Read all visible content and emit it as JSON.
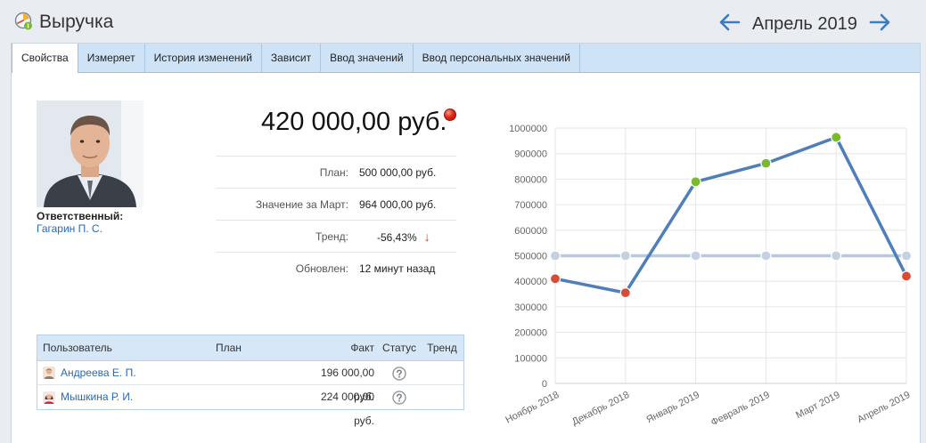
{
  "header": {
    "title": "Выручка",
    "period": "Апрель 2019"
  },
  "tabs": [
    {
      "label": "Свойства",
      "active": true
    },
    {
      "label": "Измеряет"
    },
    {
      "label": "История изменений"
    },
    {
      "label": "Зависит"
    },
    {
      "label": "Ввод значений"
    },
    {
      "label": "Ввод персональных значений"
    }
  ],
  "responsible": {
    "label": "Ответственный:",
    "name": "Гагарин П. С."
  },
  "kpi": {
    "value": "420 000,00 руб.",
    "status_color": "#e02818",
    "rows": [
      {
        "label": "План:",
        "value": "500 000,00 руб."
      },
      {
        "label": "Значение за Март:",
        "value": "964 000,00 руб."
      },
      {
        "label": "Тренд:",
        "value": "-56,43%",
        "arrow": "↓"
      },
      {
        "label": "Обновлен:",
        "value": "12 минут назад"
      }
    ]
  },
  "users_table": {
    "headers": {
      "user": "Пользователь",
      "plan": "План",
      "fact": "Факт",
      "status": "Статус",
      "trend": "Тренд"
    },
    "rows": [
      {
        "user": "Андреева Е. П.",
        "plan": "",
        "fact": "196 000,00 руб.",
        "status_icon": "question-circle-icon",
        "trend": ""
      },
      {
        "user": "Мышкина Р. И.",
        "plan": "",
        "fact": "224 000,00 руб.",
        "status_icon": "question-circle-icon",
        "trend": ""
      }
    ]
  },
  "chart_data": {
    "type": "line",
    "categories": [
      "Ноябрь 2018",
      "Декабрь 2018",
      "Январь 2019",
      "Февраль 2019",
      "Март 2019",
      "Апрель 2019"
    ],
    "ylim": [
      0,
      1000000
    ],
    "yticks": [
      "0",
      "100000",
      "200000",
      "300000",
      "400000",
      "500000",
      "600000",
      "700000",
      "800000",
      "900000",
      "1000000"
    ],
    "grid": true,
    "series": [
      {
        "values": [
          500000,
          500000,
          500000,
          500000,
          500000,
          500000
        ],
        "color": "#b7c9da",
        "point_colors": [
          "#c3d2e2",
          "#c3d2e2",
          "#c3d2e2",
          "#c3d2e2",
          "#c3d2e2",
          "#c3d2e2"
        ]
      },
      {
        "values": [
          410000,
          355000,
          790000,
          862000,
          964000,
          420000
        ],
        "color": "#4f7fb8",
        "point_colors": [
          "#d84b37",
          "#d84b37",
          "#7bba2e",
          "#7bba2e",
          "#7bba2e",
          "#d84b37"
        ]
      }
    ]
  }
}
